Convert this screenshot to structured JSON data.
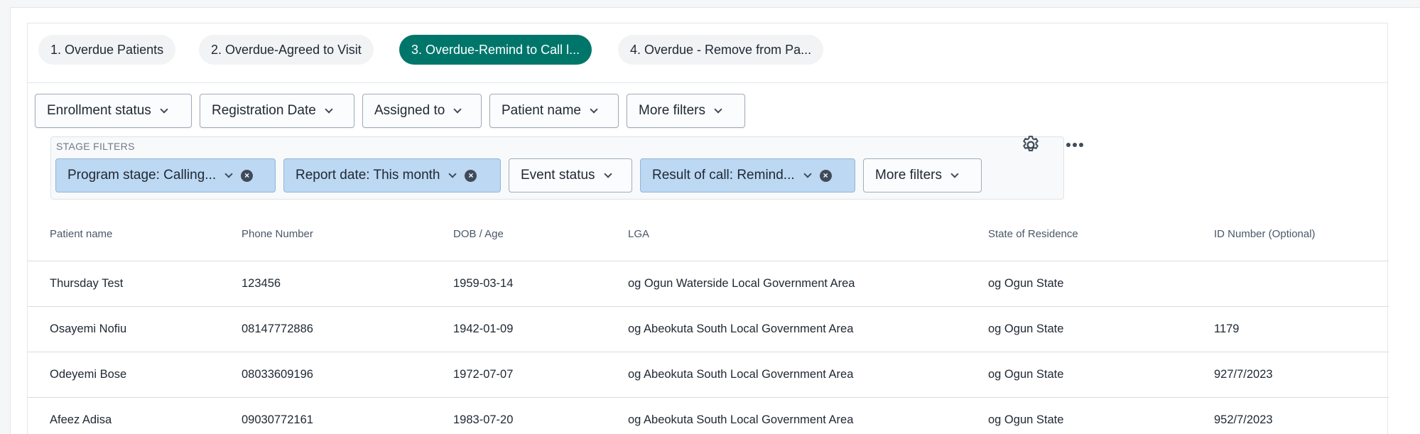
{
  "tabs": [
    {
      "label": "1. Overdue Patients",
      "active": false
    },
    {
      "label": "2. Overdue-Agreed to Visit",
      "active": false
    },
    {
      "label": "3. Overdue-Remind to Call l...",
      "active": true
    },
    {
      "label": "4. Overdue - Remove from Pa...",
      "active": false
    }
  ],
  "filters": [
    "Enrollment status",
    "Registration Date",
    "Assigned to",
    "Patient name",
    "More filters"
  ],
  "stage_filters": {
    "label": "STAGE FILTERS",
    "items": [
      {
        "label": "Program stage: Calling...",
        "applied": true
      },
      {
        "label": "Report date: This month",
        "applied": true
      },
      {
        "label": "Event status",
        "applied": false
      },
      {
        "label": "Result of call: Remind...",
        "applied": true
      },
      {
        "label": "More filters",
        "applied": false
      }
    ]
  },
  "icons": {
    "settings": "gear-icon",
    "more": "more-horizontal-icon"
  },
  "colors": {
    "accent": "#00766b",
    "applied_filter": "#bcd8f3"
  },
  "table": {
    "columns": [
      "Patient name",
      "Phone Number",
      "DOB / Age",
      "LGA",
      "State of Residence",
      "ID Number (Optional)"
    ],
    "rows": [
      [
        "Thursday Test",
        "123456",
        "1959-03-14",
        "og Ogun Waterside Local Government Area",
        "og Ogun State",
        ""
      ],
      [
        "Osayemi Nofiu",
        "08147772886",
        "1942-01-09",
        "og Abeokuta South Local Government Area",
        "og Ogun State",
        "1179"
      ],
      [
        "Odeyemi Bose",
        "08033609196",
        "1972-07-07",
        "og Abeokuta South Local Government Area",
        "og Ogun State",
        "927/7/2023"
      ],
      [
        "Afeez Adisa",
        "09030772161",
        "1983-07-20",
        "og Abeokuta South Local Government Area",
        "og Ogun State",
        "952/7/2023"
      ]
    ]
  }
}
